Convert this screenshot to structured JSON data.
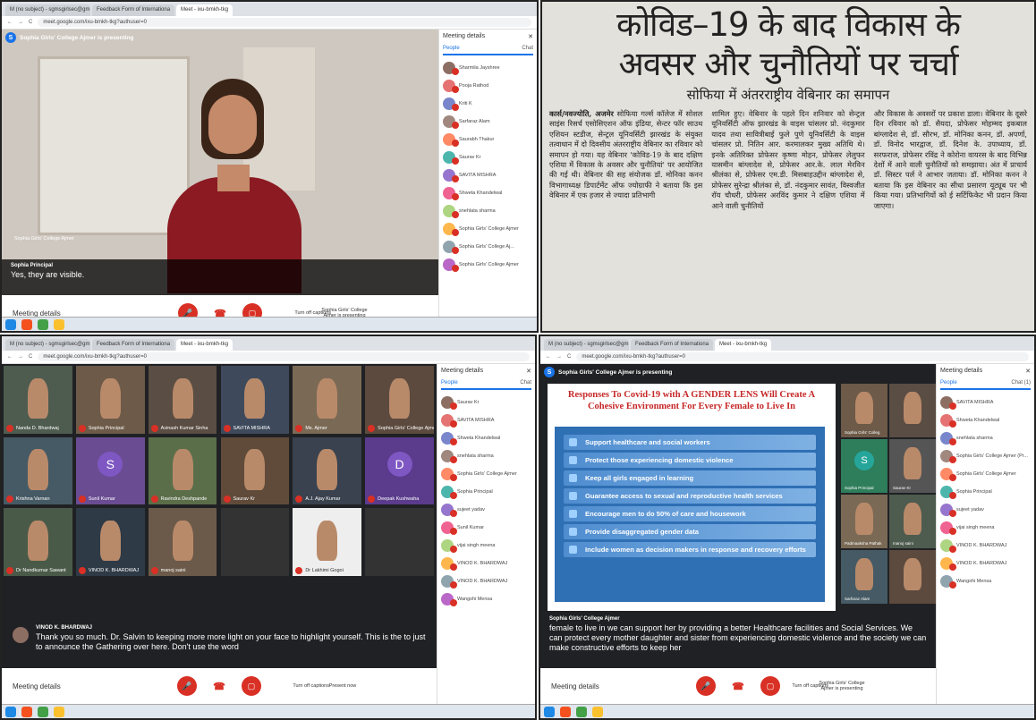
{
  "browser": {
    "tabs": [
      "M (no subject) - sgmsgirlsec@gm",
      "Feedback Form of Internationa",
      "Meet - ixu-bmkh-tkg"
    ],
    "url": "meet.google.com/ixu-bmkh-tkg?authuser=0"
  },
  "q1": {
    "presenting": "Sophia Girls' College Ajmer is presenting",
    "panel_title": "Meeting details",
    "people_tab": "People",
    "chat_tab": "Chat",
    "people": [
      "Sharmila Jayshree",
      "Pooja Rathod",
      "Kriti K",
      "Sarfaraz Alam",
      "Saurabh Thakur",
      "Saurav Kr",
      "SAVITA MISHRA",
      "Shweta Khandelwal",
      "snehlata sharma",
      "Sophia Girls' College Ajmer",
      "Sophia Girls' College Aj...",
      "Sophia Girls' College Ajmer"
    ],
    "self_label": "Sophia Girls' College Ajmer",
    "caption_name": "Sophia Principal",
    "caption_text": "Yes, they are visible.",
    "meeting_details": "Meeting details",
    "captions_label": "Turn off captions",
    "present_label": "Sophia Girls' College Ajmer is presenting"
  },
  "q2": {
    "headline1": "कोविड–19 के बाद विकास के",
    "headline2": "अवसर और चुनौतियों पर चर्चा",
    "subhead": "सोफिया में अंतरराष्ट्रीय वेबिनार का समापन",
    "dateline": "कार्स/नवज्योति, अजमेर",
    "col1": "सोफिया गर्ल्स कॉलेज में सोशल साइंस रिसर्च एसोसिएशन ऑफ इंडिया, सेन्टर फॉर साउथ एशियन स्टडीज, सेन्ट्रल यूनिवर्सिटी झारखंड के संयुक्त तत्वाधान में दो दिवसीय अंतरराष्ट्रीय वेबिनार का रविवार को समापन हो गया। यह वेबिनार 'कोविड-19 के बाद दक्षिण एशिया में विकास के अवसर और चुनौतियां' पर आयोजित की गई थी। वेबिनार की सह संयोजक डॉ. मोनिका कनन विभागाध्यक्ष डिपार्टमेंट ऑफ ज्योग्राफी ने बताया कि इस वेबिनार में एक हजार से ज्यादा प्रतिभागी",
    "col2": "शामिल हुए। वेबिनार के पहले दिन शनिवार को सेन्ट्रल यूनिवर्सिटी ऑफ झारखंड के वाइस चांसलर प्रो. नंदकुमार यादव तथा सावित्रीबाई फुले पुणे यूनिवर्सिटी के वाइस चांसलर प्रो. नितिन आर. करमालकर मुख्य अतिथि थे। इनके अतिरिक्त प्रोफेसर कृष्णा मोहन, प्रोफेसर लेलुफर यासमीन बांग्लादेश से, प्रोफेसर आर.के. लाल मेरविन श्रीलंका से, प्रोफेसर एम.डी. मिसबाहउद्दीन बांग्लादेश से, प्रोफेसर सुरेन्द्रा श्रीलंका से, डॉ. नंदकुमार सावंत, विस्वजीत रॉय चौधरी, प्रोफेसर अरविंद कुमार ने दक्षिण एशिया में आने वाली चुनौतियों",
    "col3": "और विकास के अवसरों पर प्रकाश डाला। वेबिनार के दूसरे दिन रविवार को डॉ. सैयदा, प्रोफेसर मोहम्मद इकबाल बांग्लादेश से, डॉ. सौरभ, डॉ. मोनिका कनन, डॉ. अपर्णा, डॉ. विनोद भारद्वाज, डॉ. दिनेश के. उपाध्याय, डॉ. सरफराज, प्रोफेसर रविंद्र ने कोरोना वायरस के बाद विभिन्न देशों में आने वाली चुनौतियों को समझाया। अंत में प्राचार्य डॉ. सिस्टर पर्ल ने आभार जताया। डॉ. मोनिका कनन ने बताया कि इस वेबिनार का सीधा प्रसारण यूट्यूब पर भी किया गया। प्रतिभागियों को ई सर्टिफिकेट भी प्रदान किया जाएगा।"
  },
  "q3": {
    "panel_title": "Meeting details",
    "people_tab": "People",
    "chat_tab": "Chat",
    "people": [
      "Saurav Kr",
      "SAVITA MISHRA",
      "Shweta Khandelwal",
      "snehlata sharma",
      "Sophia Girls' College Ajmer",
      "Sophia Principal",
      "sujeet yadav",
      "Sunil Kumar",
      "vijai singh meena",
      "VINOD K. BHARDWAJ",
      "VINOD K. BHARDWAJ",
      "Wangshi Mensa"
    ],
    "tiles": [
      "Nanda D. Bhardwaj",
      "Sophia Principal",
      "Avinash Kumar Sinha",
      "SAVITA MISHRA",
      "Ms. Ajmer",
      "Sophia Girls' College Ajmer",
      "Krishna Varnan",
      "Sunil Kumar",
      "Ravindra Deshpande",
      "Saurav Kr",
      "A.J. Ajay Kumar",
      "Deepak Kushwaha",
      "Dr Nandkumar Sawant",
      "VINOD K. BHARDWAJ",
      "manoj saini",
      "",
      "Dr Lakhimi Gogoi",
      ""
    ],
    "letters": [
      "S",
      "D"
    ],
    "caption_name": "VINOD K. BHARDWAJ",
    "caption_text": "Thank you so much. Dr. Salvin to keeping more more light on your face to highlight yourself. This is the to just to announce the Gathering over here. Don't use the word",
    "meeting_details": "Meeting details",
    "captions_label": "Turn off captions",
    "present_label": "Present now"
  },
  "q4": {
    "presenting": "Sophia Girls' College Ajmer is presenting",
    "slide_title": "Responses To Covid-19 with A GENDER LENS Will Create A Cohesive Environment For Every Female to Live In",
    "bullets": [
      "Support healthcare and social workers",
      "Protect those experiencing domestic violence",
      "Keep all girls engaged in learning",
      "Guarantee access to sexual and reproductive health services",
      "Encourage men to do 50% of care and housework",
      "Provide disaggregated gender data",
      "Include women as decision makers in response and recovery efforts"
    ],
    "panel_title": "Meeting details",
    "people_tab": "People",
    "chat_tab": "Chat (1)",
    "people": [
      "SAVITA MISHRA",
      "Shweta Khandelwal",
      "snehlata sharma",
      "Sophia Girls' College Ajmer (Pr...",
      "Sophia Girls' College Ajmer",
      "Sophia Principal",
      "sujeet yadav",
      "vijai singh meena",
      "VINOD K. BHARDWAJ",
      "VINOD K. BHARDWAJ",
      "Wangshi Mensa"
    ],
    "tiles": [
      "Sophia Girls' Colleg",
      "",
      "Sophia Principal",
      "Saurav Kr",
      "Padmaaksha Pathak",
      "manoj saini",
      "Sarfaraz Alam",
      ""
    ],
    "caption_name": "Sophia Girls' College Ajmer",
    "caption_text": "female to live in we can support her by providing a better Healthcare facilities and Social Services. We can protect every mother daughter and sister from experiencing domestic violence and the society we can make constructive efforts to keep her",
    "meeting_details": "Meeting details",
    "captions_label": "Turn off captions",
    "present_label": "Sophia Girls' College Ajmer is presenting"
  }
}
